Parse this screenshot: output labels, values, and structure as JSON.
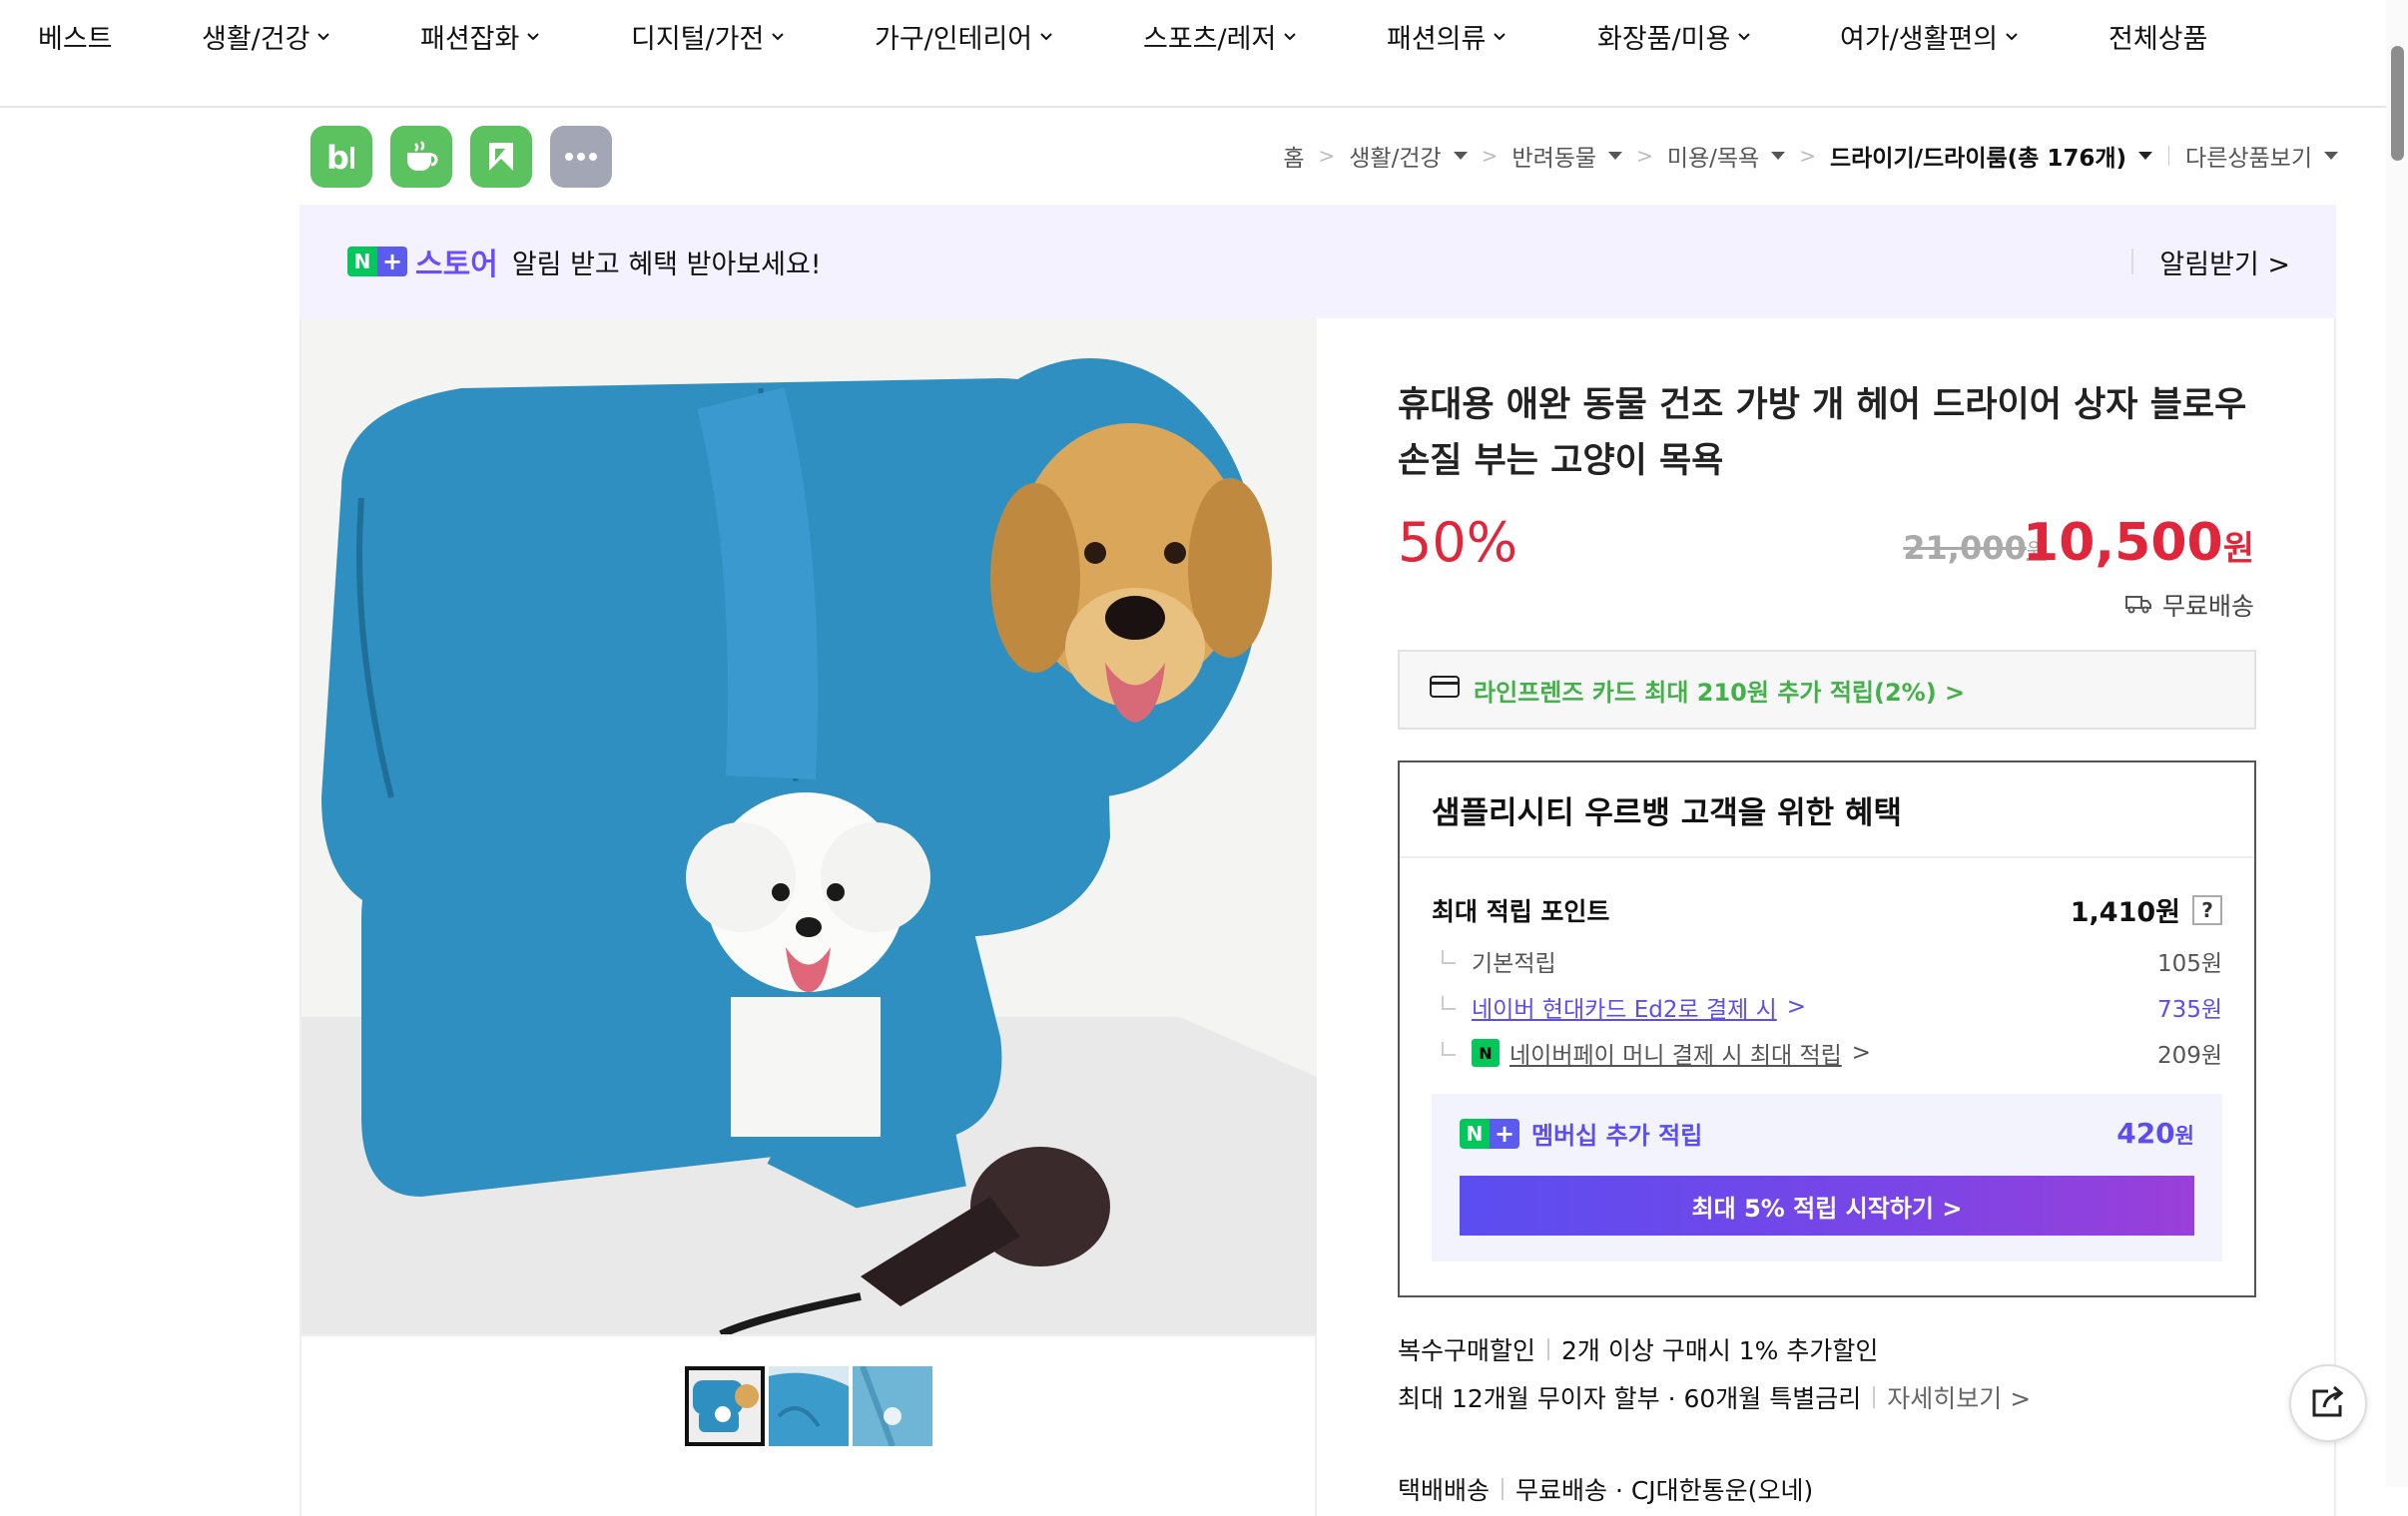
{
  "topnav": [
    {
      "label": "베스트",
      "has_menu": false
    },
    {
      "label": "생활/건강",
      "has_menu": true
    },
    {
      "label": "패션잡화",
      "has_menu": true
    },
    {
      "label": "디지털/가전",
      "has_menu": true
    },
    {
      "label": "가구/인테리어",
      "has_menu": true
    },
    {
      "label": "스포츠/레저",
      "has_menu": true
    },
    {
      "label": "패션의류",
      "has_menu": true
    },
    {
      "label": "화장품/미용",
      "has_menu": true
    },
    {
      "label": "여가/생활편의",
      "has_menu": true
    },
    {
      "label": "전체상품",
      "has_menu": false
    }
  ],
  "service_icons": [
    {
      "name": "band-icon",
      "color": "#5cc15f"
    },
    {
      "name": "cafe-icon",
      "color": "#5cc15f"
    },
    {
      "name": "blog-icon",
      "color": "#5cc15f"
    },
    {
      "name": "more-icon",
      "color": "#a3a6b4"
    }
  ],
  "breadcrumb": {
    "items": [
      "홈",
      "생활/건강",
      "반려동물",
      "미용/목욕",
      "드라이기/드라이룸(총 176개)"
    ],
    "other": "다른상품보기"
  },
  "banner": {
    "badge_n": "N",
    "badge_plus": "+",
    "store": "스토어",
    "text": "알림 받고 혜택 받아보세요!",
    "action": "알림받기 >"
  },
  "product": {
    "title": "휴대용 애완 동물 건조 가방 개 헤어 드라이어 상자 블로우 손질 부는 고양이 목욕",
    "discount": "50%",
    "original_price": "21,000",
    "original_unit": "원",
    "sale_price": "10,500",
    "sale_unit": "원",
    "shipping": "무료배송",
    "card_benefit": "라인프렌즈 카드 최대 210원 추가 적립(2%) >"
  },
  "benefit": {
    "title": "샘플리시티 우르뱅 고객을 위한 혜택",
    "max_points_label": "최대 적립 포인트",
    "max_points_value": "1,410원",
    "help": "?",
    "rows": [
      {
        "label": "기본적립",
        "value": "105원"
      },
      {
        "label": "네이버 현대카드 Ed2로 결제 시",
        "value": "735원"
      },
      {
        "label": "네이버페이 머니 결제 시 최대 적립",
        "value": "209원"
      }
    ],
    "npay_badge": "N",
    "membership_label": "멤버십 추가 적립",
    "membership_value": "420",
    "membership_unit": "원",
    "membership_button": "최대 5% 적립 시작하기 >"
  },
  "extras": {
    "multi_label": "복수구매할인",
    "multi_text": "2개 이상 구매시 1% 추가할인",
    "installment": "최대 12개월 무이자 할부 · 60개월 특별금리",
    "more": "자세히보기 >",
    "delivery_label": "택배배송",
    "delivery_text": "무료배송 · CJ대한통운(오네)"
  },
  "colors": {
    "accent": "#e0263a",
    "naver_green": "#03c75a",
    "membership_purple": "#5b4df0"
  }
}
